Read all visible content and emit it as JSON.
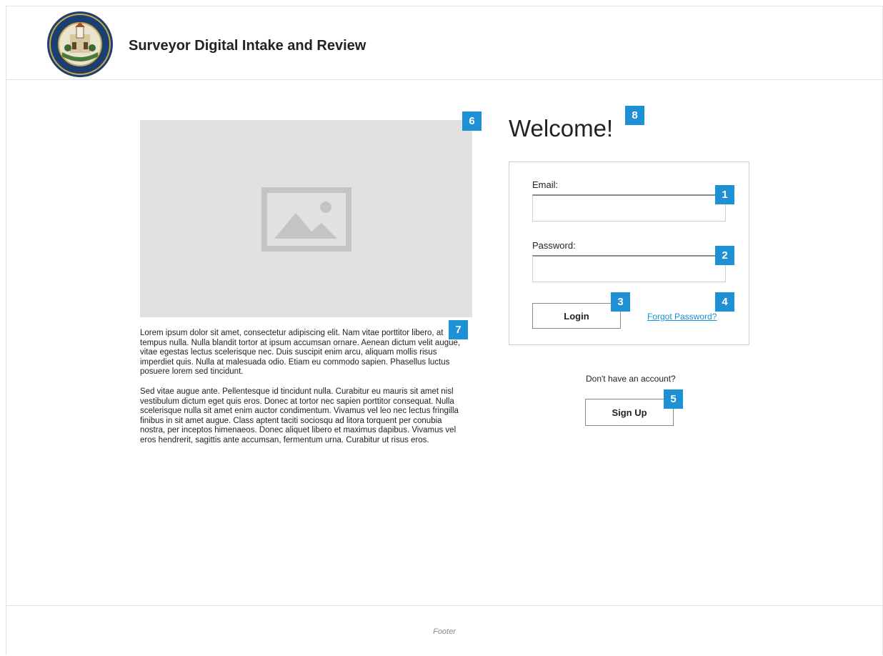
{
  "header": {
    "title": "Surveyor Digital Intake and Review"
  },
  "hero": {
    "image_icon": "image-placeholder-icon"
  },
  "body_paragraphs": [
    "Lorem ipsum dolor sit amet, consectetur adipiscing elit. Nam vitae porttitor libero, at tempus nulla. Nulla blandit tortor at ipsum accumsan ornare. Aenean dictum velit augue, vitae egestas lectus scelerisque nec. Duis suscipit enim arcu, aliquam mollis risus imperdiet quis. Nulla at malesuada odio. Etiam eu commodo sapien. Phasellus luctus posuere lorem sed tincidunt.",
    "Sed vitae augue ante. Pellentesque id tincidunt nulla. Curabitur eu mauris sit amet nisl vestibulum dictum eget quis eros. Donec at tortor nec sapien porttitor consequat. Nulla scelerisque nulla sit amet enim auctor condimentum. Vivamus vel leo nec lectus fringilla finibus in sit amet augue. Class aptent taciti sociosqu ad litora torquent per conubia nostra, per inceptos himenaeos. Donec aliquet libero et maximus dapibus. Vivamus vel eros hendrerit, sagittis ante accumsan, fermentum urna. Curabitur ut risus eros."
  ],
  "login": {
    "welcome": "Welcome!",
    "email_label": "Email:",
    "email_value": "",
    "password_label": "Password:",
    "password_value": "",
    "login_button": "Login",
    "forgot_link": "Forgot Password?"
  },
  "signup": {
    "prompt": "Don't have an account?",
    "button": "Sign Up"
  },
  "badges": [
    "1",
    "2",
    "3",
    "4",
    "5",
    "6",
    "7",
    "8"
  ],
  "footer": {
    "text": "Footer"
  },
  "colors": {
    "accent": "#1e90d6",
    "link": "#1a8fd6",
    "placeholder_bg": "#e1e1e1"
  }
}
